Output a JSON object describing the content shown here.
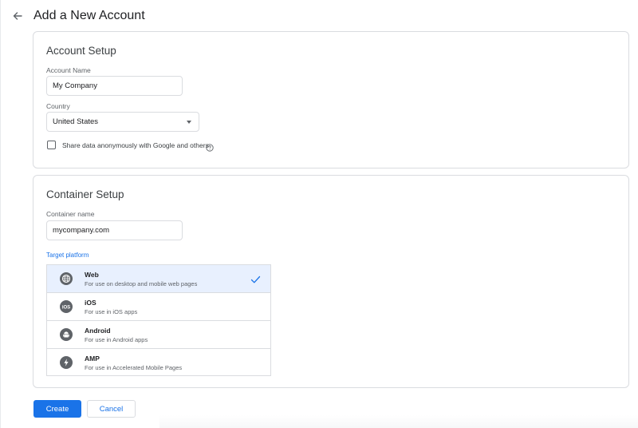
{
  "header": {
    "title": "Add a New Account",
    "back_icon": "arrow-left-icon"
  },
  "account_setup": {
    "title": "Account Setup",
    "account_name": {
      "label": "Account Name",
      "value": "My Company"
    },
    "country": {
      "label": "Country",
      "value": "United States"
    },
    "share_data": {
      "label": "Share data anonymously with Google and others",
      "checked": false,
      "help_icon": "help-circle-icon"
    }
  },
  "container_setup": {
    "title": "Container Setup",
    "container_name": {
      "label": "Container name",
      "value": "mycompany.com"
    },
    "target_platform_label": "Target platform",
    "platforms": [
      {
        "name": "Web",
        "description": "For use on desktop and mobile web pages",
        "icon": "globe-icon",
        "selected": true
      },
      {
        "name": "iOS",
        "description": "For use in iOS apps",
        "icon": "ios-icon",
        "selected": false
      },
      {
        "name": "Android",
        "description": "For use in Android apps",
        "icon": "android-icon",
        "selected": false
      },
      {
        "name": "AMP",
        "description": "For use in Accelerated Mobile Pages",
        "icon": "amp-bolt-icon",
        "selected": false
      }
    ]
  },
  "actions": {
    "create_label": "Create",
    "cancel_label": "Cancel"
  },
  "colors": {
    "accent": "#1a73e8",
    "selected_bg": "#e8f0fe",
    "border": "#dadce0"
  }
}
